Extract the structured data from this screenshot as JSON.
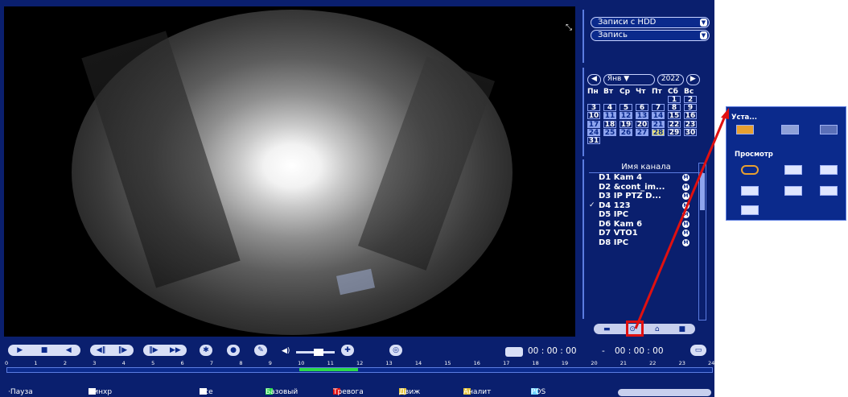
{
  "source": {
    "mode": "Записи с HDD",
    "type": "Запись"
  },
  "calendar": {
    "month": "Янв",
    "year": "2022",
    "weekdays": [
      "Пн",
      "Вт",
      "Ср",
      "Чт",
      "Пт",
      "Сб",
      "Вс"
    ],
    "rows": [
      [
        "",
        "",
        "",
        "",
        "",
        "1",
        "2"
      ],
      [
        "3",
        "4",
        "5",
        "6",
        "7",
        "8",
        "9"
      ],
      [
        "10",
        "11",
        "12",
        "13",
        "14",
        "15",
        "16"
      ],
      [
        "17",
        "18",
        "19",
        "20",
        "21",
        "22",
        "23"
      ],
      [
        "24",
        "25",
        "26",
        "27",
        "28",
        "29",
        "30"
      ],
      [
        "31",
        "",
        "",
        "",
        "",
        "",
        ""
      ]
    ],
    "recorded_days": [
      "11",
      "12",
      "13",
      "14",
      "17",
      "21",
      "24",
      "25",
      "26",
      "27"
    ],
    "selected_day": "28"
  },
  "channels": {
    "header": "Имя канала",
    "items": [
      {
        "name": "D1 Kam 4",
        "checked": false
      },
      {
        "name": "D2 &cont_im...",
        "checked": false
      },
      {
        "name": "D3 IP PTZ D...",
        "checked": false
      },
      {
        "name": "D4 123",
        "checked": true
      },
      {
        "name": "D5 IPC",
        "checked": false
      },
      {
        "name": "D6 Kam 6",
        "checked": false
      },
      {
        "name": "D7 VTO1",
        "checked": false
      },
      {
        "name": "D8 IPC",
        "checked": false
      }
    ],
    "badge": "M"
  },
  "controls": {
    "time_start": "00 : 00 : 00",
    "separator": "-",
    "time_end": "00 : 00 : 00"
  },
  "timeline": {
    "hours": [
      "0",
      "1",
      "2",
      "3",
      "4",
      "5",
      "6",
      "7",
      "8",
      "9",
      "10",
      "11",
      "12",
      "13",
      "14",
      "15",
      "16",
      "17",
      "18",
      "19",
      "20",
      "21",
      "22",
      "23",
      "24"
    ],
    "recorded_range": [
      10.0,
      12.0
    ]
  },
  "legend": {
    "pause": "Пауза",
    "sync": "Синхр",
    "all": "Все",
    "base": "Базовый",
    "alarm": "Тревога",
    "motion": "Движ",
    "analytics": "Аналит",
    "pos": "POS"
  },
  "popup": {
    "title1": "Уста...",
    "title2": "Просмотр"
  },
  "colors": {
    "frame": "#0a1f6e",
    "panel": "#0b2a8c",
    "record": "#2bd84a",
    "alarm": "#e01010",
    "highlight": "#e01010"
  }
}
